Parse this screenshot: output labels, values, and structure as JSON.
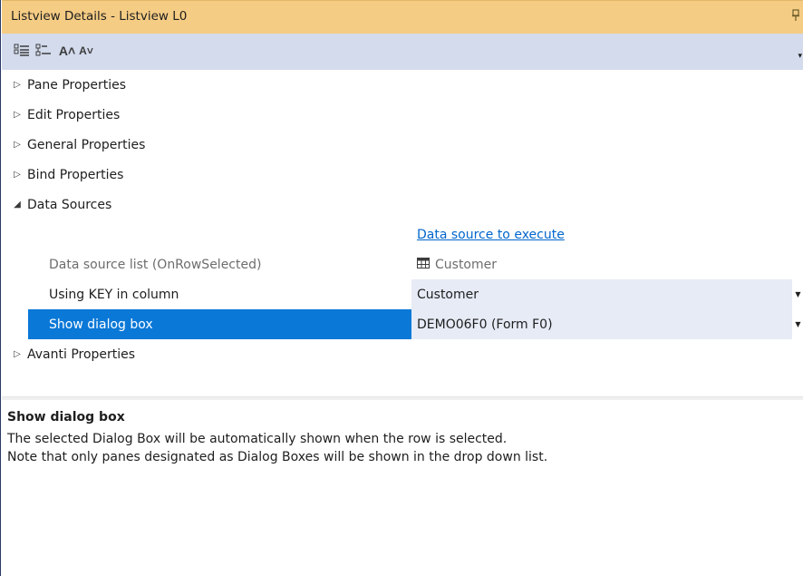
{
  "window": {
    "title": "Listview Details - Listview L0",
    "pin_glyph": "ᛘ"
  },
  "toolbar": {
    "categorized_icon": "categorized-view-icon",
    "alphabetical_icon": "alphabetical-view-icon",
    "increase_font_label": "A˄",
    "decrease_font_label": "A˅",
    "overflow_glyph": "▾"
  },
  "categories": {
    "pane": "Pane Properties",
    "edit": "Edit Properties",
    "general": "General Properties",
    "bind": "Bind Properties",
    "data_sources": "Data Sources",
    "avanti": "Avanti Properties"
  },
  "data_sources": {
    "link_text": "Data source to execute",
    "rows": [
      {
        "name": "Data source list (OnRowSelected)",
        "value": "Customer",
        "disabled": true
      },
      {
        "name": "Using KEY in column",
        "value": "Customer",
        "disabled": false
      },
      {
        "name": "Show dialog box",
        "value": "DEMO06F0 (Form F0)",
        "disabled": false,
        "selected": true
      }
    ]
  },
  "description": {
    "title": "Show dialog box",
    "line1": "The selected Dialog Box will be automatically shown when the row is selected.",
    "line2": "Note that only panes designated as Dialog Boxes will be shown in the drop down list."
  },
  "colors": {
    "title_bar": "#f5cc84",
    "toolbar": "#d3dbed",
    "selected": "#0a78d7",
    "value_bg": "#e6ebf6",
    "link": "#0066cc"
  }
}
